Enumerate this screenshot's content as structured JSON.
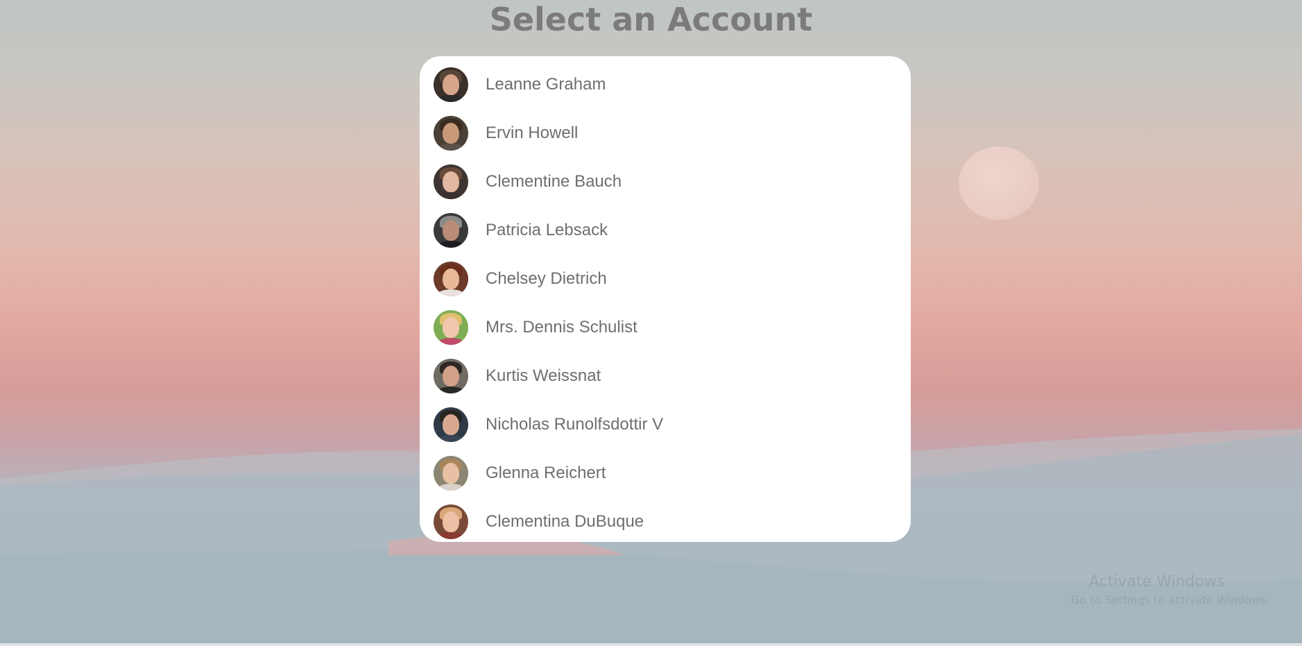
{
  "page": {
    "title": "Select an Account"
  },
  "accounts": [
    {
      "name": "Leanne Graham",
      "bg": "#3b2f2a",
      "skin": "#d7a58a",
      "hair": "#5a4636",
      "shirt": "#2a2a2a"
    },
    {
      "name": "Ervin Howell",
      "bg": "#4a4036",
      "skin": "#c89a7a",
      "hair": "#3a2b20",
      "shirt": "#5b5148"
    },
    {
      "name": "Clementine Bauch",
      "bg": "#3e3532",
      "skin": "#e2b8a2",
      "hair": "#6a4a38",
      "shirt": "#3a3030"
    },
    {
      "name": "Patricia Lebsack",
      "bg": "#3a3a3c",
      "skin": "#b98d78",
      "hair": "#8b8b8b",
      "shirt": "#1e1e22"
    },
    {
      "name": "Chelsey Dietrich",
      "bg": "#6b3a28",
      "skin": "#e8b898",
      "hair": "#6a2e1a",
      "shirt": "#e9e2dc"
    },
    {
      "name": "Mrs. Dennis Schulist",
      "bg": "#7eae54",
      "skin": "#f0c8ae",
      "hair": "#e0c070",
      "shirt": "#c04a6a"
    },
    {
      "name": "Kurtis Weissnat",
      "bg": "#6f6a62",
      "skin": "#d0a088",
      "hair": "#2e2622",
      "shirt": "#2a2826"
    },
    {
      "name": "Nicholas Runolfsdottir V",
      "bg": "#2e3a46",
      "skin": "#d8a890",
      "hair": "#2a2420",
      "shirt": "#3a4656"
    },
    {
      "name": "Glenna Reichert",
      "bg": "#8a8672",
      "skin": "#e8c0a4",
      "hair": "#a8865a",
      "shirt": "#d8d2c8"
    },
    {
      "name": "Clementina DuBuque",
      "bg": "#7a4a38",
      "skin": "#ecc0a4",
      "hair": "#d8a878",
      "shirt": "#8a3a30"
    }
  ],
  "watermark": {
    "title": "Activate Windows",
    "subtitle": "Go to Settings to activate Windows."
  }
}
